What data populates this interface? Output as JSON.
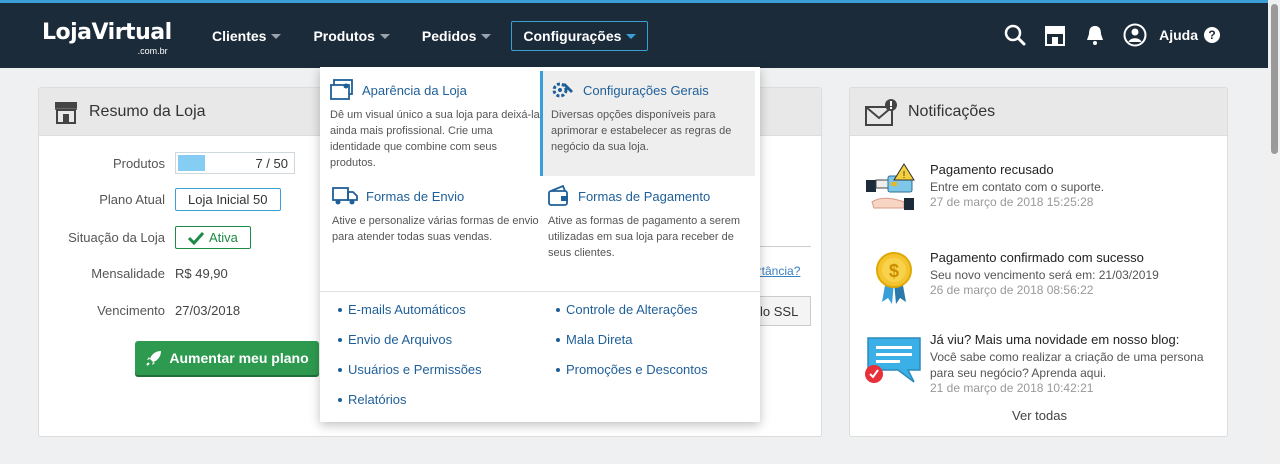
{
  "brand": {
    "logo_main": "LojaVirtual",
    "logo_sub": ".com.br"
  },
  "nav": [
    {
      "label": "Clientes"
    },
    {
      "label": "Produtos"
    },
    {
      "label": "Pedidos"
    },
    {
      "label": "Configurações"
    }
  ],
  "top_icons": [
    "search-icon",
    "store-icon",
    "bell-icon",
    "user-icon"
  ],
  "help": {
    "label": "Ajuda",
    "q": "?"
  },
  "resumo": {
    "title": "Resumo da Loja",
    "produtos_label": "Produtos",
    "produtos_value": "7 / 50",
    "produtos_fill": 0.23,
    "plano_label": "Plano Atual",
    "plano_value": "Loja Inicial 50",
    "situacao_label": "Situação da Loja",
    "situacao_value": "Ativa",
    "mensalidade_label": "Mensalidade",
    "mensalidade_value": "R$ 49,90",
    "vencimento_label": "Vencimento",
    "vencimento_value": "27/03/2018",
    "upgrade_button": "Aumentar meu plano",
    "importance_link": "ortância?",
    "ssl_button": "lo SSL"
  },
  "dropdown": {
    "sections": [
      {
        "title": "Aparência da Loja",
        "desc": "Dê um visual único a sua loja para deixá-la ainda mais profissional. Crie uma identidade que combine com seus produtos."
      },
      {
        "title": "Configurações Gerais",
        "desc": "Diversas opções disponíveis para aprimorar e estabelecer as regras de negócio da sua loja."
      },
      {
        "title": "Formas de Envio",
        "desc": "Ative e personalize várias formas de envio para atender todas suas vendas."
      },
      {
        "title": "Formas de Pagamento",
        "desc": "Ative as formas de pagamento a serem utilizadas em sua loja para receber de seus clientes."
      }
    ],
    "links": [
      "E-mails Automáticos",
      "Controle de Alterações",
      "Envio de Arquivos",
      "Mala Direta",
      "Usuários e Permissões",
      "Promoções e Descontos",
      "Relatórios"
    ]
  },
  "notificacoes": {
    "title": "Notificações",
    "items": [
      {
        "title": "Pagamento recusado",
        "body": "Entre em contato com o suporte.",
        "date": "27 de março de 2018 15:25:28"
      },
      {
        "title": "Pagamento confirmado com sucesso",
        "body": "Seu novo vencimento será em: 21/03/2019",
        "date": "26 de março de 2018 08:56:22"
      },
      {
        "title": "Já viu? Mais uma novidade em nosso blog:",
        "body": "Você sabe como realizar a criação de uma persona para seu negócio? Aprenda aqui.",
        "date": "21 de março de 2018 10:42:21"
      }
    ],
    "ver_todas": "Ver todas"
  },
  "colors": {
    "topbar": "#1c2b3a",
    "accent": "#3a9fd6",
    "green": "#2d9a4f",
    "link": "#1f5f99"
  }
}
